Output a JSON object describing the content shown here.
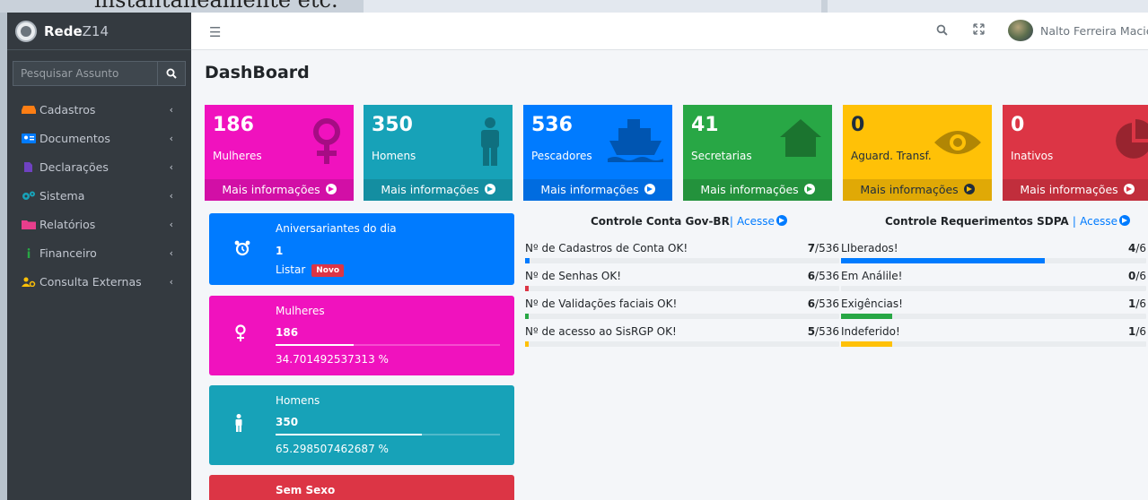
{
  "background": {
    "text": "instantaneamente etc."
  },
  "brand": {
    "name_bold": "Rede",
    "name_light": "Z14"
  },
  "search": {
    "placeholder": "Pesquisar Assunto"
  },
  "sidebar": {
    "items": [
      {
        "label": "Cadastros",
        "icon": "hdd-icon",
        "icon_color": "#fd7e14"
      },
      {
        "label": "Documentos",
        "icon": "id-card-icon",
        "icon_color": "#007bff"
      },
      {
        "label": "Declarações",
        "icon": "file-icon",
        "icon_color": "#6f42c1"
      },
      {
        "label": "Sistema",
        "icon": "cogs-icon",
        "icon_color": "#17a2b8"
      },
      {
        "label": "Relatórios",
        "icon": "folder-icon",
        "icon_color": "#e83e8c"
      },
      {
        "label": "Financeiro",
        "icon": "info-icon",
        "icon_color": "#28a745"
      },
      {
        "label": "Consulta Externas",
        "icon": "users-cog-icon",
        "icon_color": "#ffc107"
      }
    ]
  },
  "topbar": {
    "user_name": "Nalto Ferreira Maciel"
  },
  "page": {
    "title": "DashBoard"
  },
  "small_boxes": [
    {
      "value": "186",
      "label": "Mulheres",
      "footer": "Mais informações",
      "color": "#f012be",
      "icon": "venus-icon"
    },
    {
      "value": "350",
      "label": "Homens",
      "footer": "Mais informações",
      "color": "#17a2b8",
      "icon": "male-icon"
    },
    {
      "value": "536",
      "label": "Pescadores",
      "footer": "Mais informações",
      "color": "#007bff",
      "icon": "ship-icon"
    },
    {
      "value": "41",
      "label": "Secretarias",
      "footer": "Mais informações",
      "color": "#28a745",
      "icon": "home-icon"
    },
    {
      "value": "0",
      "label": "Aguard. Transf.",
      "footer": "Mais informações",
      "color": "#ffc107",
      "icon": "eye-icon"
    },
    {
      "value": "0",
      "label": "Inativos",
      "footer": "Mais informações",
      "color": "#dc3545",
      "icon": "pie-chart-icon"
    }
  ],
  "info_cards": {
    "aniversariantes": {
      "title": "Aniversariantes do dia",
      "count": "1",
      "link": "Listar",
      "badge": "Novo"
    },
    "mulheres": {
      "title": "Mulheres",
      "count": "186",
      "percent": "34.701492537313 %",
      "progress": 0.347
    },
    "homens": {
      "title": "Homens",
      "count": "350",
      "percent": "65.298507462687 %",
      "progress": 0.653
    },
    "sem_sexo": {
      "title": "Sem Sexo"
    }
  },
  "gov_br": {
    "title": "Controle Conta Gov-BR",
    "separator": "|",
    "link": "Acesse",
    "rows": [
      {
        "label": "Nº de Cadastros de Conta OK!",
        "value": "7",
        "total": "/536",
        "fraction": 0.013,
        "color": "#007bff"
      },
      {
        "label": "Nº de Senhas OK!",
        "value": "6",
        "total": "/536",
        "fraction": 0.011,
        "color": "#dc3545"
      },
      {
        "label": "Nº de Validações faciais OK!",
        "value": "6",
        "total": "/536",
        "fraction": 0.011,
        "color": "#28a745"
      },
      {
        "label": "Nº de acesso ao SisRGP OK!",
        "value": "5",
        "total": "/536",
        "fraction": 0.009,
        "color": "#ffc107"
      }
    ]
  },
  "sdpa": {
    "title": "Controle Requerimentos SDPA",
    "separator": "|",
    "link": "Acesse",
    "rows": [
      {
        "label": "LIberados!",
        "value": "4",
        "total": "/6",
        "fraction": 0.6667,
        "color": "#007bff"
      },
      {
        "label": "Em Análile!",
        "value": "0",
        "total": "/6",
        "fraction": 0,
        "color": "#dc3545"
      },
      {
        "label": "Exigências!",
        "value": "1",
        "total": "/6",
        "fraction": 0.1667,
        "color": "#28a745"
      },
      {
        "label": "Indeferido!",
        "value": "1",
        "total": "/6",
        "fraction": 0.1667,
        "color": "#ffc107"
      }
    ]
  }
}
